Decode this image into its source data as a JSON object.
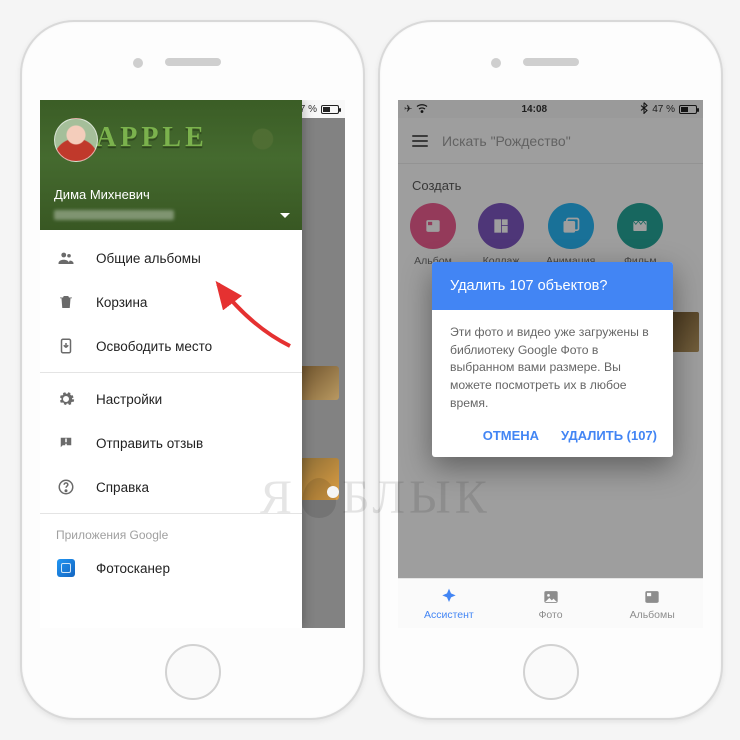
{
  "status": {
    "time": "14:08",
    "battery_pct": "47 %"
  },
  "user": {
    "name": "Дима Михневич"
  },
  "header_logo": "APPLE",
  "menu": {
    "items": [
      {
        "key": "shared-albums",
        "label": "Общие альбомы",
        "icon": "people"
      },
      {
        "key": "trash",
        "label": "Корзина",
        "icon": "trash"
      },
      {
        "key": "freeup",
        "label": "Освободить место",
        "icon": "freeup"
      }
    ],
    "items2": [
      {
        "key": "settings",
        "label": "Настройки",
        "icon": "gear"
      },
      {
        "key": "feedback",
        "label": "Отправить отзыв",
        "icon": "feedback"
      },
      {
        "key": "help",
        "label": "Справка",
        "icon": "help"
      }
    ],
    "apps_header": "Приложения Google",
    "apps": [
      {
        "key": "photoscan",
        "label": "Фотосканер"
      }
    ]
  },
  "search": {
    "placeholder": "Искать \"Рождество\""
  },
  "create": {
    "title": "Создать",
    "items": [
      {
        "label": "Альбом"
      },
      {
        "label": "Коллаж"
      },
      {
        "label": "Анимация"
      },
      {
        "label": "Фильм"
      }
    ]
  },
  "dialog": {
    "title": "Удалить 107 объектов?",
    "body": "Эти фото и видео уже загружены в библиотеку Google Фото в выбранном вами размере. Вы можете посмотреть их в любое время.",
    "cancel": "ОТМЕНА",
    "confirm": "УДАЛИТЬ (107)"
  },
  "tabs": {
    "assistant": "Ассистент",
    "photos": "Фото",
    "albums": "Альбомы"
  },
  "watermark": "БЛЫК"
}
